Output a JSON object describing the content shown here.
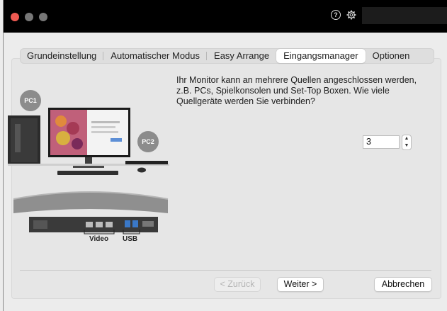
{
  "titlebar": {
    "help_icon": "question-circle-icon",
    "settings_icon": "gear-icon"
  },
  "tabs": [
    {
      "label": "Grundeinstellung",
      "active": false
    },
    {
      "label": "Automatischer Modus",
      "active": false
    },
    {
      "label": "Easy Arrange",
      "active": false
    },
    {
      "label": "Eingangsmanager",
      "active": true
    },
    {
      "label": "Optionen",
      "active": false
    }
  ],
  "main": {
    "intro_lines": [
      "Ihr Monitor kann an mehrere Quellen angeschlossen werden,",
      "z.B. PCs, Spielkonsolen und Set-Top Boxen. Wie viele",
      "Quellgeräte werden Sie verbinden?"
    ],
    "source_count": "3"
  },
  "illustration": {
    "pc1_label": "PC1",
    "pc2_label": "PC2",
    "port_video_label": "Video",
    "port_usb_label": "USB"
  },
  "buttons": {
    "back_label": "< Zurück",
    "next_label": "Weiter >",
    "cancel_label": "Abbrechen"
  },
  "colors": {
    "close": "#ee5a52",
    "titlebar": "#000000",
    "window_bg": "#ececec"
  }
}
